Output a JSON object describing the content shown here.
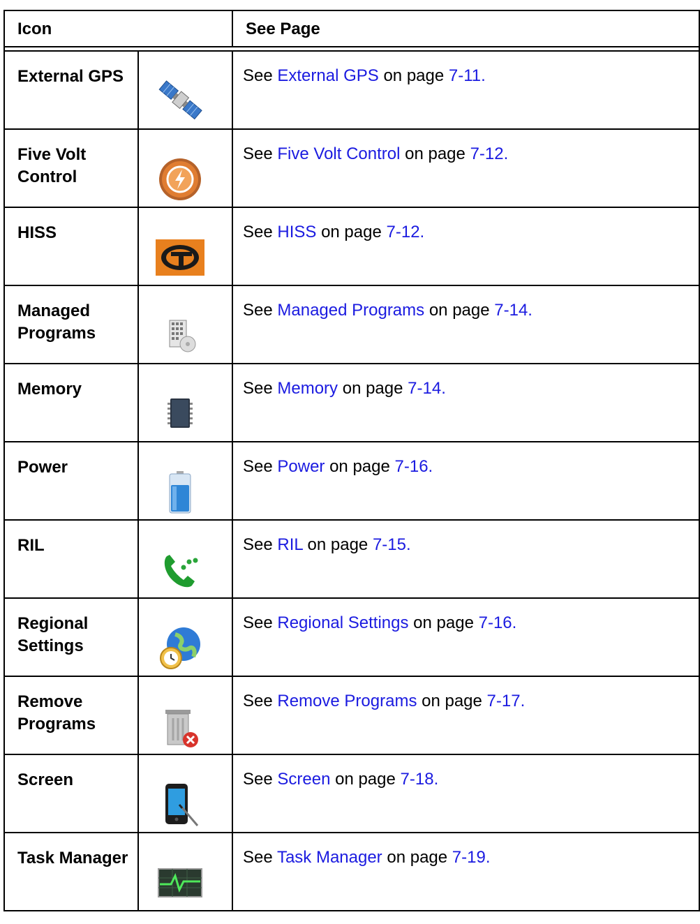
{
  "header": {
    "col_icon": "Icon",
    "col_page": "See Page"
  },
  "text": {
    "see": "See",
    "on_page": "on page"
  },
  "rows": [
    {
      "name": "External GPS",
      "icon": "satellite-icon",
      "link": "External GPS",
      "page": "7-11."
    },
    {
      "name": "Five Volt Control",
      "icon": "lightning-power-icon",
      "link": "Five Volt Control",
      "page": "7-12."
    },
    {
      "name": "HISS",
      "icon": "hiss-logo-icon",
      "link": "HISS",
      "page": "7-12."
    },
    {
      "name": "Managed Programs",
      "icon": "managed-programs-icon",
      "link": "Managed Programs",
      "page": "7-14."
    },
    {
      "name": "Memory",
      "icon": "memory-chip-icon",
      "link": "Memory",
      "page": "7-14."
    },
    {
      "name": "Power",
      "icon": "battery-icon",
      "link": "Power",
      "page": "7-16."
    },
    {
      "name": "RIL",
      "icon": "phone-icon",
      "link": "RIL",
      "page": "7-15."
    },
    {
      "name": "Regional Settings",
      "icon": "globe-clock-icon",
      "link": "Regional Settings",
      "page": "7-16."
    },
    {
      "name": "Remove Programs",
      "icon": "trash-remove-icon",
      "link": "Remove Programs",
      "page": "7-17."
    },
    {
      "name": "Screen",
      "icon": "screen-stylus-icon",
      "link": "Screen",
      "page": "7-18."
    },
    {
      "name": "Task Manager",
      "icon": "task-manager-icon",
      "link": "Task Manager",
      "page": "7-19."
    }
  ],
  "colors": {
    "link": "#1b1be0",
    "border": "#000000"
  }
}
